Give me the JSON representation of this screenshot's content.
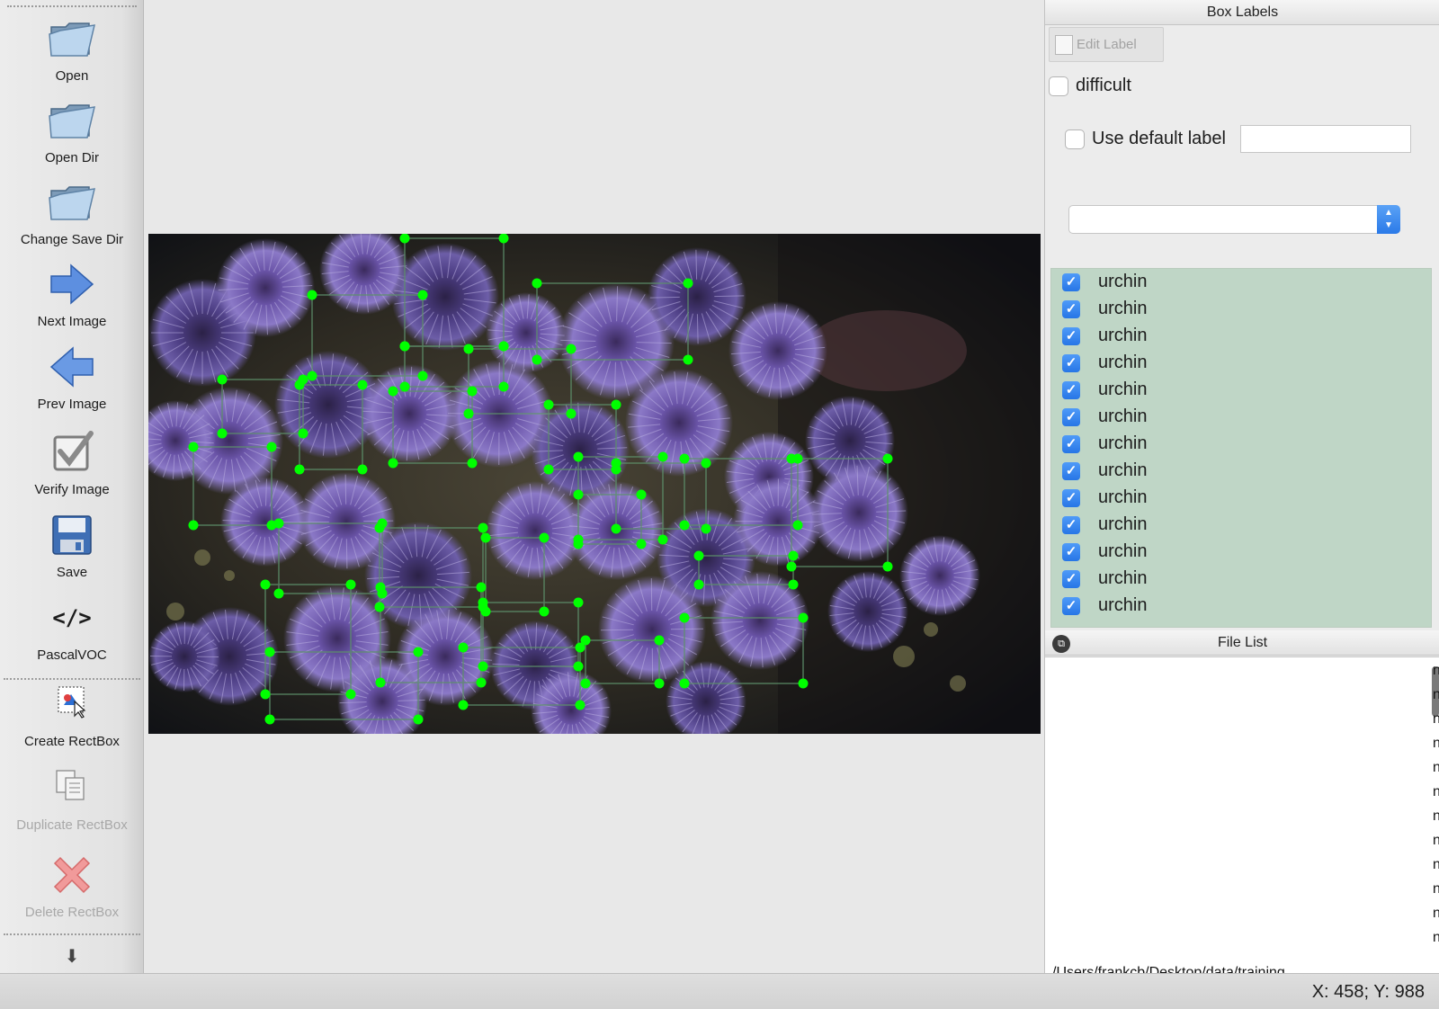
{
  "toolbar": {
    "open": "Open",
    "open_dir": "Open Dir",
    "change_save_dir": "Change Save Dir",
    "next_image": "Next Image",
    "prev_image": "Prev Image",
    "verify_image": "Verify Image",
    "save": "Save",
    "format": "PascalVOC",
    "format_icon": "</>",
    "create_rectbox": "Create RectBox",
    "duplicate_rectbox": "Duplicate RectBox",
    "delete_rectbox": "Delete RectBox"
  },
  "box_labels": {
    "title": "Box Labels",
    "edit_label": "Edit Label",
    "difficult": "difficult",
    "use_default_label": "Use default label",
    "default_label_value": "",
    "combo_value": "",
    "items": [
      {
        "label": "urchin",
        "checked": true
      },
      {
        "label": "urchin",
        "checked": true
      },
      {
        "label": "urchin",
        "checked": true
      },
      {
        "label": "urchin",
        "checked": true
      },
      {
        "label": "urchin",
        "checked": true
      },
      {
        "label": "urchin",
        "checked": true
      },
      {
        "label": "urchin",
        "checked": true
      },
      {
        "label": "urchin",
        "checked": true
      },
      {
        "label": "urchin",
        "checked": true
      },
      {
        "label": "urchin",
        "checked": true
      },
      {
        "label": "urchin",
        "checked": true
      },
      {
        "label": "urchin",
        "checked": true
      },
      {
        "label": "urchin",
        "checked": true
      }
    ]
  },
  "file_list": {
    "title": "File List",
    "visible_fragment": "n",
    "row_count": 12
  },
  "status": {
    "coords": "X: 458; Y: 988"
  },
  "colors": {
    "box_vertex": "#00ff00",
    "label_list_bg": "#bfd6c6",
    "accent": "#2b7ae8"
  }
}
